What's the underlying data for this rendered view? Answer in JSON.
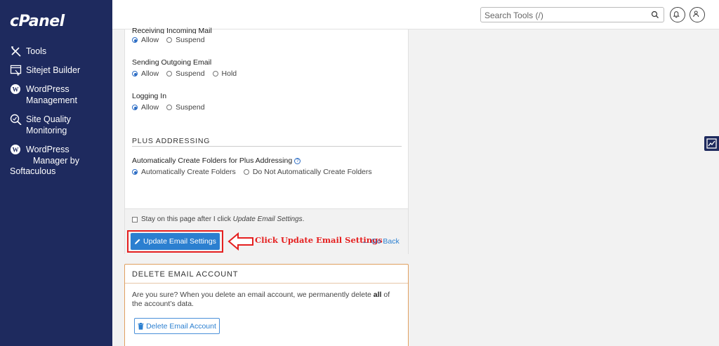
{
  "brand": {
    "logo_text": "cPanel"
  },
  "sidebar": {
    "items": [
      {
        "label": "Tools",
        "icon": "tools-icon"
      },
      {
        "label": "Sitejet Builder",
        "icon": "sitejet-icon"
      },
      {
        "label_line1": "WordPress",
        "label_line2": "Management",
        "icon": "wordpress-icon"
      },
      {
        "label_line1": "Site Quality",
        "label_line2": "Monitoring",
        "icon": "site-quality-icon"
      },
      {
        "label_line1": "WordPress",
        "label_line2": "Manager by",
        "label_line3": "Softaculous",
        "icon": "wordpress-icon"
      }
    ]
  },
  "topbar": {
    "search_placeholder": "Search Tools (/)"
  },
  "settings": {
    "receiving": {
      "label": "Receiving Incoming Mail",
      "options": [
        "Allow",
        "Suspend"
      ],
      "selected": "Allow"
    },
    "sending": {
      "label": "Sending Outgoing Email",
      "options": [
        "Allow",
        "Suspend",
        "Hold"
      ],
      "selected": "Allow"
    },
    "login": {
      "label": "Logging In",
      "options": [
        "Allow",
        "Suspend"
      ],
      "selected": "Allow"
    },
    "plus": {
      "section_title": "PLUS ADDRESSING",
      "label": "Automatically Create Folders for Plus Addressing",
      "help": "?",
      "options": [
        "Automatically Create Folders",
        "Do Not Automatically Create Folders"
      ],
      "selected": "Automatically Create Folders"
    }
  },
  "footer": {
    "stay_text_prefix": "Stay on this page after I click ",
    "stay_text_em": "Update Email Settings",
    "stay_text_suffix": ".",
    "update_button": "Update Email Settings",
    "annotation": "Click Update Email Settings",
    "go_back": "Go Back"
  },
  "delete_panel": {
    "title": "DELETE EMAIL ACCOUNT",
    "text_before": "Are you sure? When you delete an email account, we permanently delete ",
    "text_bold": "all",
    "text_after": " of the account’s data.",
    "button": "Delete Email Account"
  },
  "colors": {
    "sidebar_bg": "#1e2a5e",
    "primary": "#2b7fd0",
    "annotation_red": "#e52020",
    "delete_border": "#e0a060"
  }
}
